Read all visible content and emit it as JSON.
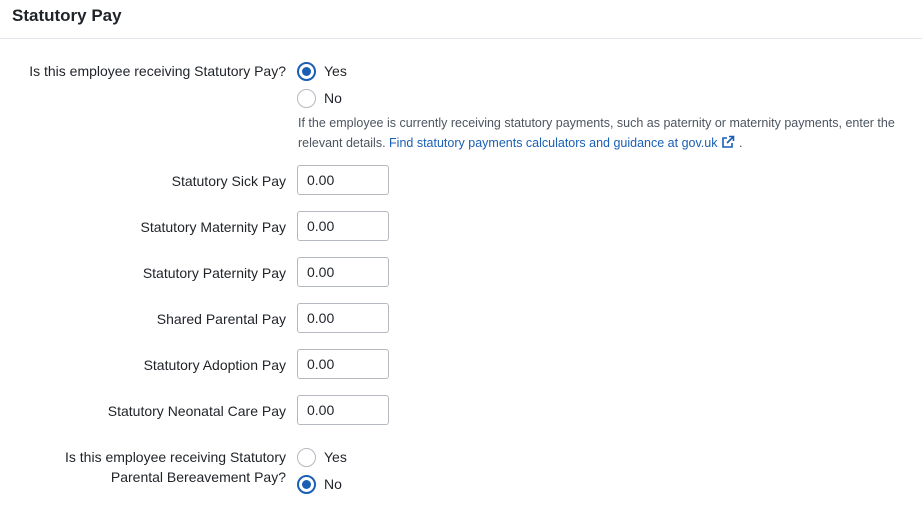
{
  "header": {
    "title": "Statutory Pay"
  },
  "statutory_question": {
    "label": "Is this employee receiving Statutory Pay?",
    "options": [
      {
        "label": "Yes",
        "checked": true
      },
      {
        "label": "No",
        "checked": false
      }
    ],
    "help_text": "If the employee is currently receiving statutory payments, such as paternity or maternity payments, enter the relevant details.",
    "help_link": "Find statutory payments calculators and guidance at gov.uk",
    "help_suffix": "."
  },
  "fields": [
    {
      "label": "Statutory Sick Pay",
      "value": "0.00"
    },
    {
      "label": "Statutory Maternity Pay",
      "value": "0.00"
    },
    {
      "label": "Statutory Paternity Pay",
      "value": "0.00"
    },
    {
      "label": "Shared Parental Pay",
      "value": "0.00"
    },
    {
      "label": "Statutory Adoption Pay",
      "value": "0.00"
    },
    {
      "label": "Statutory Neonatal Care Pay",
      "value": "0.00"
    }
  ],
  "bereavement_question": {
    "label_line1": "Is this employee receiving Statutory",
    "label_line2": "Parental Bereavement Pay?",
    "options": [
      {
        "label": "Yes",
        "checked": false
      },
      {
        "label": "No",
        "checked": true
      }
    ]
  },
  "colors": {
    "accent": "#1a5fb4",
    "border": "#b4b9bf",
    "divider": "#e3e6ea"
  }
}
